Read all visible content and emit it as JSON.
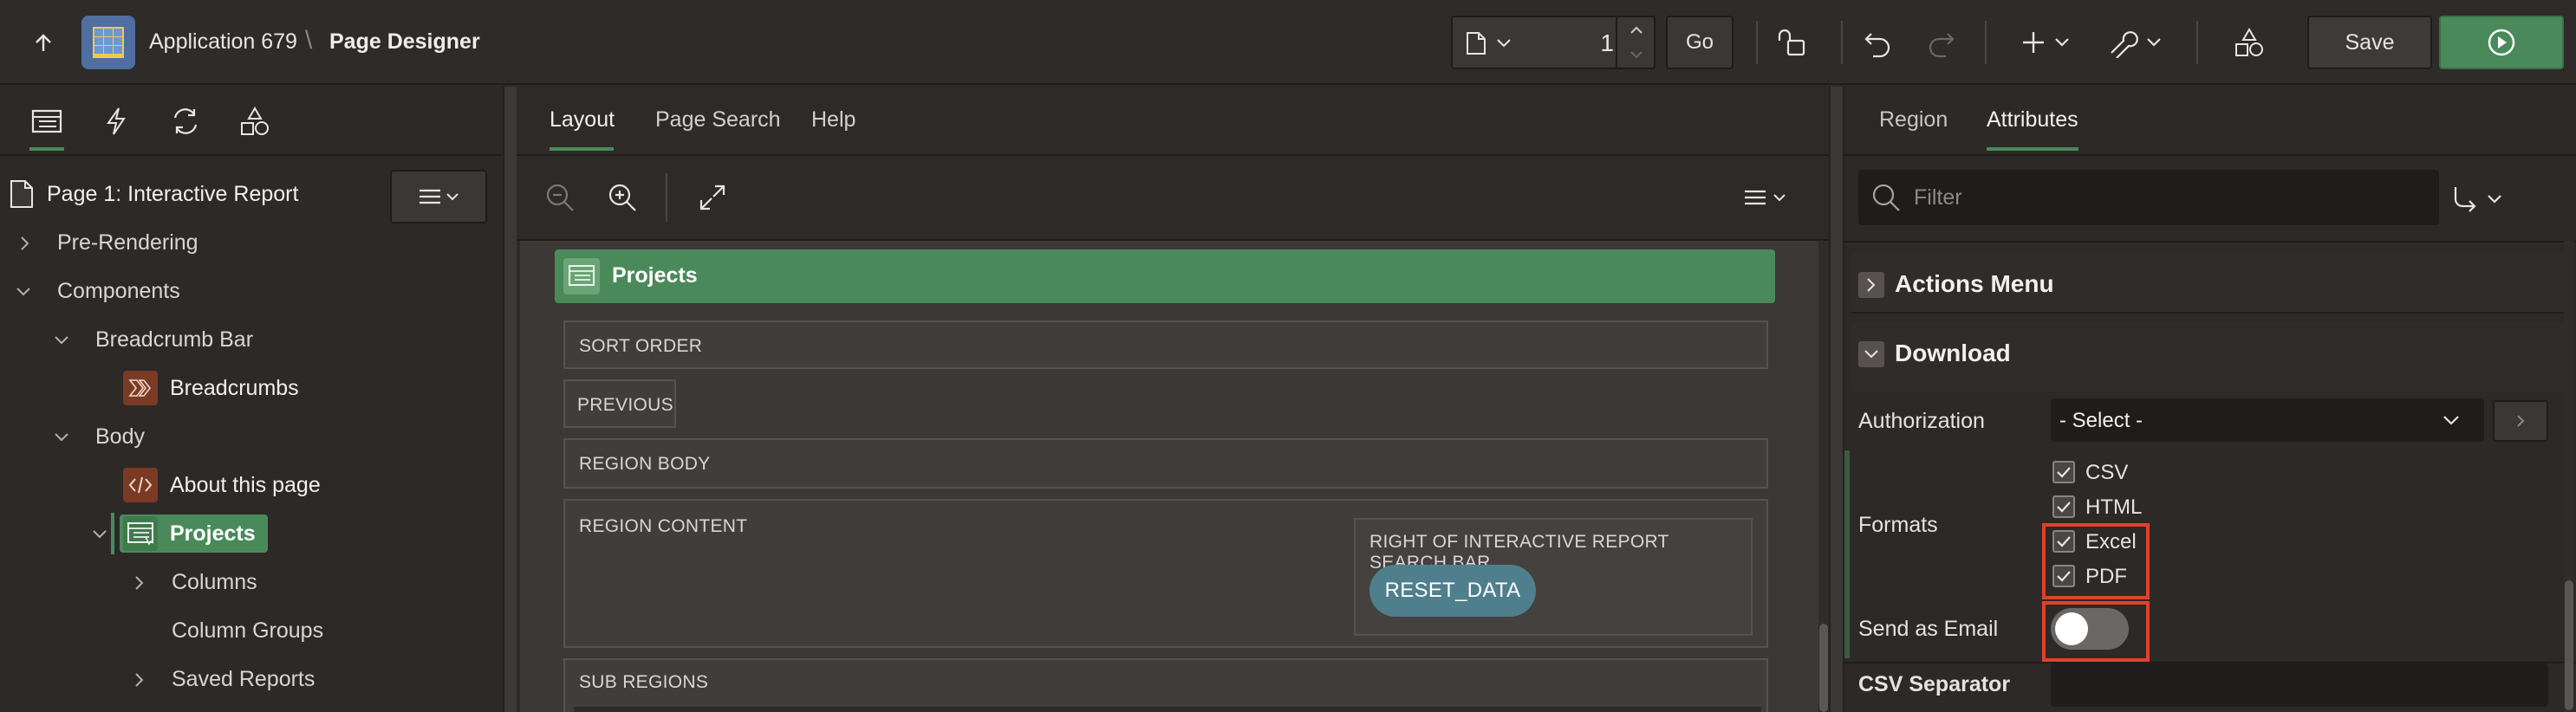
{
  "header": {
    "app_name": "Application 679",
    "separator": "\\",
    "page_title": "Page Designer",
    "page_number": "1",
    "go_label": "Go",
    "save_label": "Save"
  },
  "left": {
    "page_node": "Page 1: Interactive Report",
    "tree": {
      "pre_rendering": "Pre-Rendering",
      "components": "Components",
      "breadcrumb_bar": "Breadcrumb Bar",
      "breadcrumbs": "Breadcrumbs",
      "body": "Body",
      "about": "About this page",
      "projects": "Projects",
      "columns": "Columns",
      "column_groups": "Column Groups",
      "saved_reports": "Saved Reports"
    }
  },
  "center": {
    "tabs": [
      "Layout",
      "Page Search",
      "Help"
    ],
    "region_title": "Projects",
    "zones": {
      "sort_order": "SORT ORDER",
      "previous": "PREVIOUS",
      "region_body": "REGION BODY",
      "region_content": "REGION CONTENT",
      "right_of_search": "RIGHT OF INTERACTIVE REPORT SEARCH BAR",
      "reset_button": "RESET_DATA",
      "sub_regions": "SUB REGIONS"
    }
  },
  "right": {
    "tabs": [
      "Region",
      "Attributes"
    ],
    "active_tab": "Attributes",
    "filter_placeholder": "Filter",
    "sections": {
      "actions_menu": "Actions Menu",
      "download": "Download"
    },
    "authorization": {
      "label": "Authorization",
      "value": "- Select -"
    },
    "formats": {
      "label": "Formats",
      "options": [
        {
          "label": "CSV",
          "checked": true
        },
        {
          "label": "HTML",
          "checked": true
        },
        {
          "label": "Excel",
          "checked": true
        },
        {
          "label": "PDF",
          "checked": true
        }
      ]
    },
    "send_as_email": {
      "label": "Send as Email",
      "on": false
    },
    "csv_separator": {
      "label": "CSV Separator"
    }
  },
  "colors": {
    "accent_green": "#4a8a5a",
    "highlight_red": "#e0412a",
    "button_teal": "#4f7f8c",
    "breadcrumb_icon": "#7a3a24"
  }
}
